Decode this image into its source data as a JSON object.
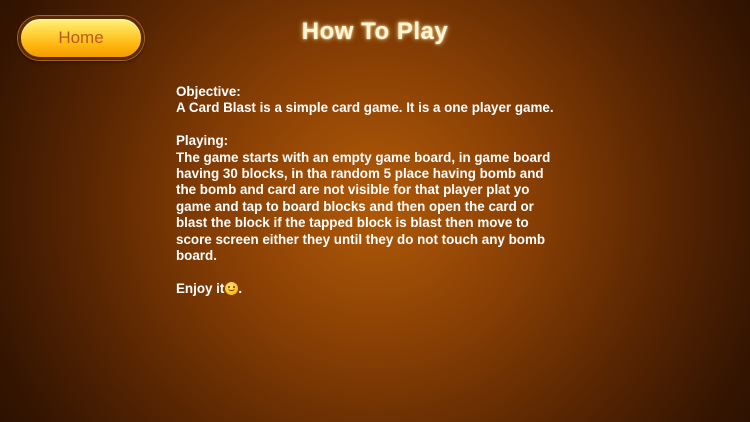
{
  "header": {
    "home_label": "Home",
    "title": "How To  Play"
  },
  "content": {
    "objective_heading": "Objective:",
    "objective_text": "A Card Blast is a simple card game. It is a one player game.",
    "playing_heading": "Playing:",
    "playing_lines": [
      "The game starts with an empty game board, in game board",
      "having 30 blocks, in tha random 5 place having bomb and",
      "the bomb and card are not visible for that player plat yo",
      "game and tap to board blocks and then open the card or",
      "blast the block if the tapped block is blast then move to",
      "score screen either they until they do not touch any bomb",
      "board."
    ],
    "enjoy_text": "Enjoy it",
    "enjoy_icon": "smiley-icon",
    "enjoy_suffix": "."
  },
  "colors": {
    "background_center": "#b05a08",
    "background_edge": "#2a1001",
    "button_fill": "#ffd23a",
    "button_text": "#b85a1e",
    "title_text": "#fff6d6",
    "body_text": "#ffffff"
  }
}
